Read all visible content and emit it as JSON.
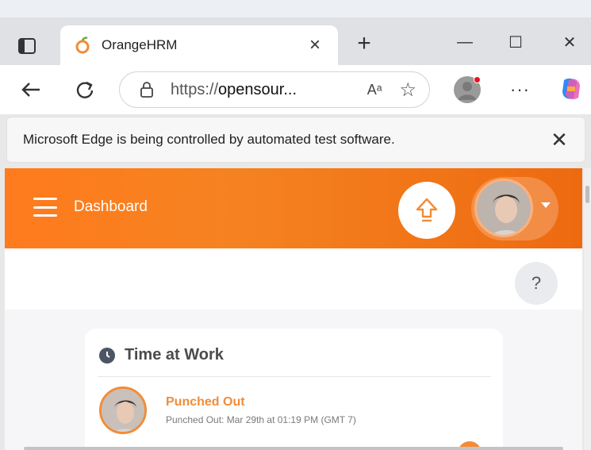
{
  "browser": {
    "tab": {
      "title": "OrangeHRM",
      "close": "×"
    },
    "new_tab": "+",
    "window": {
      "minimize": "—",
      "maximize": "☐",
      "close": "✕"
    },
    "address": {
      "prefix": "https://",
      "host": "opensour...",
      "read_aloud": "Aᵃ",
      "favorite": "☆"
    },
    "more": "···",
    "info_bar": {
      "message": "Microsoft Edge is being controlled by automated test software.",
      "close": "✕"
    }
  },
  "header": {
    "title": "Dashboard"
  },
  "help": {
    "label": "?"
  },
  "widget": {
    "title": "Time at Work",
    "status": "Punched Out",
    "detail": "Punched Out: Mar 29th at 01:19 PM (GMT 7)"
  },
  "colors": {
    "brand_orange": "#f58220",
    "status_orange": "#f28c38"
  }
}
